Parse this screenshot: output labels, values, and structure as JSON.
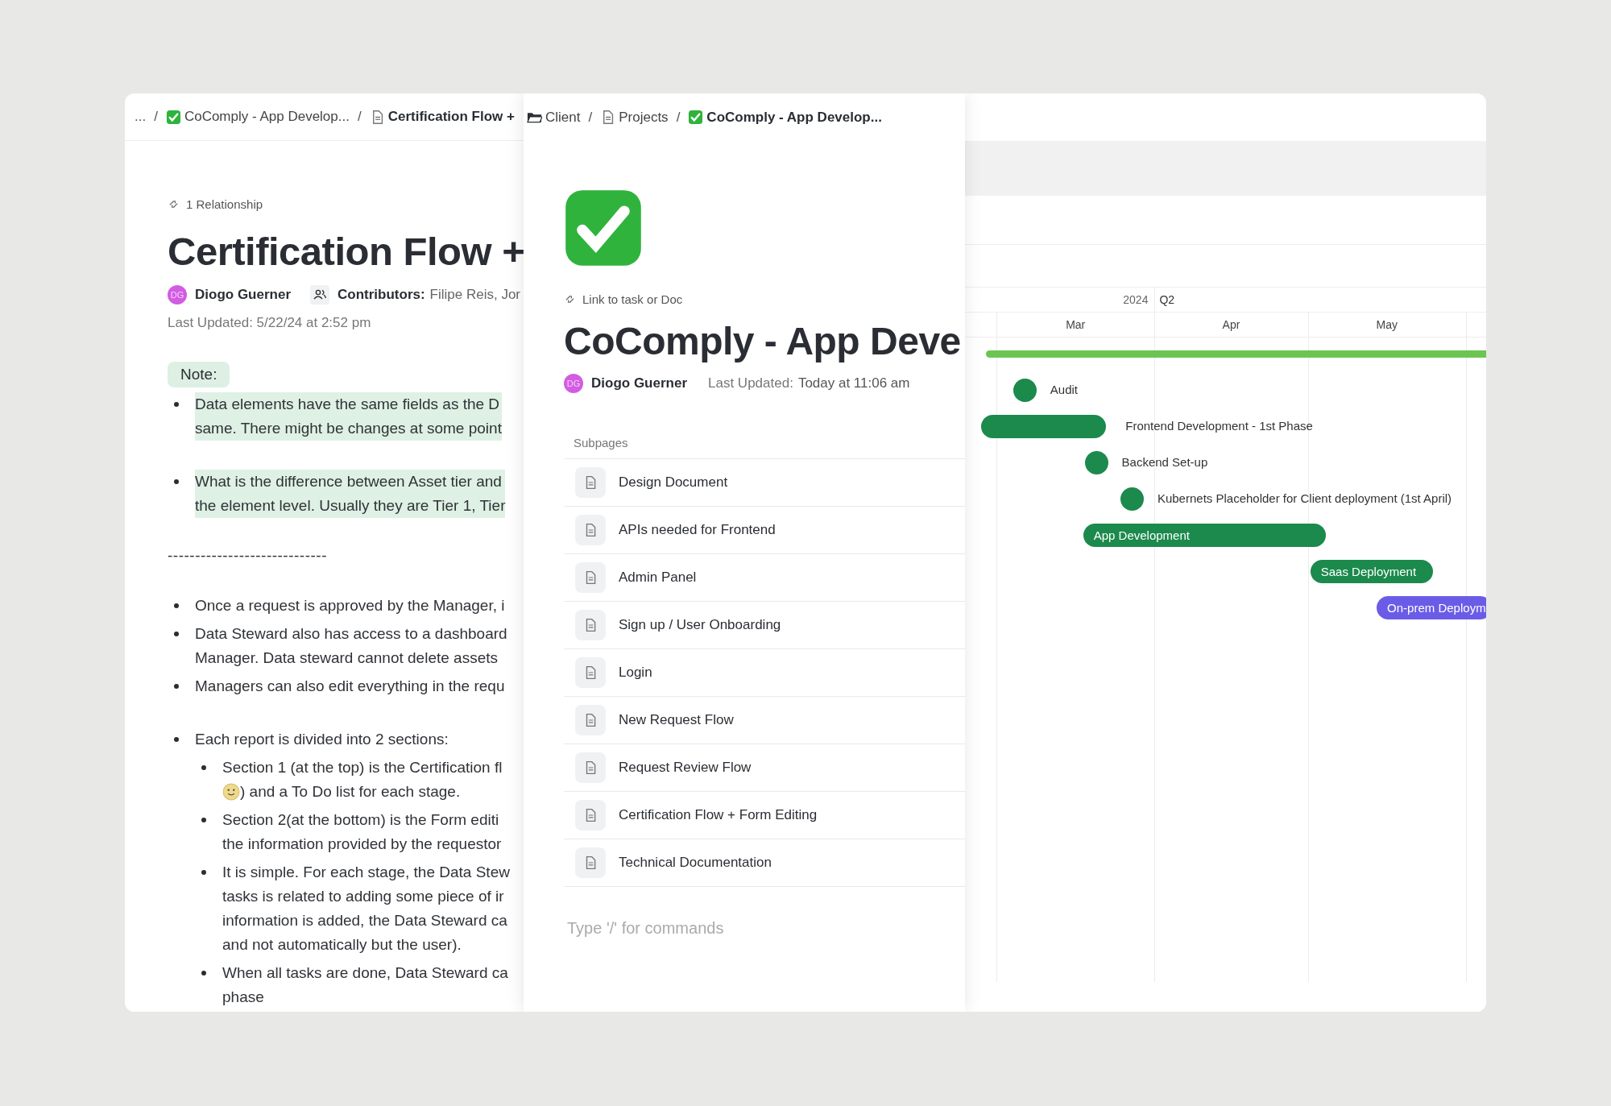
{
  "left_doc": {
    "breadcrumb": [
      {
        "kind": "ellipsis",
        "text": "..."
      },
      {
        "kind": "separator",
        "text": "/"
      },
      {
        "kind": "task_link",
        "text": "CoComply - App Develop...",
        "current": false
      },
      {
        "kind": "separator",
        "text": "/"
      },
      {
        "kind": "doc_link",
        "text": "Certification Flow +",
        "current": true
      }
    ],
    "relationship": "1 Relationship",
    "title": "Certification Flow +",
    "author": {
      "initials": "DG",
      "name": "Diogo Guerner"
    },
    "contributors": {
      "label": "Contributors:",
      "names": "Filipe Reis, Jor"
    },
    "last_updated": "Last Updated: 5/22/24 at 2:52 pm",
    "note_label": "Note:",
    "blocks": [
      {
        "kind": "bullets",
        "items": [
          {
            "highlighted": true,
            "lines": [
              "Data elements have the same fields as the D",
              "same. There might be changes at some point"
            ]
          }
        ]
      },
      {
        "kind": "bullets",
        "items": [
          {
            "highlighted": true,
            "lines": [
              "What is the difference between Asset tier and",
              "the element level. Usually they are Tier 1, Tier"
            ]
          }
        ]
      },
      {
        "kind": "rule_text",
        "text": "-----------------------------"
      },
      {
        "kind": "bullets",
        "items": [
          {
            "highlighted": false,
            "lines": [
              "Once a request is approved by the Manager, i"
            ]
          },
          {
            "highlighted": false,
            "lines": [
              "Data Steward also has access to a dashboard",
              "Manager. Data steward cannot delete assets"
            ]
          },
          {
            "highlighted": false,
            "lines": [
              "Managers can also edit everything in the requ"
            ]
          }
        ]
      },
      {
        "kind": "bullets",
        "items": [
          {
            "highlighted": false,
            "lines": [
              "Each report is divided into 2 sections:"
            ],
            "children": [
              {
                "highlighted": false,
                "lines": [
                  "Section 1 (at the top) is the Certification fl",
                  {
                    "kind": "smiley_line",
                    "text": ") and a To Do list for each stage."
                  }
                ]
              },
              {
                "highlighted": false,
                "lines": [
                  "Section 2(at the bottom) is the Form editi",
                  "the information provided by the requestor"
                ]
              },
              {
                "highlighted": false,
                "lines": [
                  "It is simple. For each stage, the Data Stew",
                  "tasks is related to adding some piece of ir",
                  "information is added, the Data Steward ca",
                  "and not automatically but the user)."
                ]
              },
              {
                "highlighted": false,
                "lines": [
                  "When all tasks are done, Data Steward ca",
                  "phase"
                ]
              }
            ]
          }
        ]
      }
    ]
  },
  "middle_doc": {
    "breadcrumb": [
      {
        "kind": "folder_link",
        "text": "Client",
        "current": false
      },
      {
        "kind": "separator",
        "text": "/"
      },
      {
        "kind": "doc_link",
        "text": "Projects",
        "current": false
      },
      {
        "kind": "separator",
        "text": "/"
      },
      {
        "kind": "task_link",
        "text": "CoComply - App Develop...",
        "current": true
      }
    ],
    "link_label": "Link to task or Doc",
    "title": "CoComply - App Deve",
    "author": {
      "initials": "DG",
      "name": "Diogo Guerner"
    },
    "updated_label": "Last Updated:",
    "updated_value": "Today at 11:06 am",
    "subpages": {
      "heading": "Subpages",
      "items": [
        "Design Document",
        "APIs needed for Frontend",
        "Admin Panel",
        "Sign up / User Onboarding",
        "Login",
        "New Request Flow",
        "Request Review Flow",
        "Certification Flow + Form Editing",
        "Technical Documentation"
      ]
    },
    "editor": {
      "placeholder": "Type '/' for commands"
    }
  },
  "gantt": {
    "year": "2024",
    "quarter": "Q2",
    "months": [
      "Mar",
      "Apr",
      "May"
    ],
    "items": [
      {
        "kind": "summary",
        "color": "#6cc551"
      },
      {
        "kind": "milestone",
        "label": "Audit",
        "color": "#1b8a4c"
      },
      {
        "kind": "bar_outside_label",
        "label": "Frontend Development - 1st Phase",
        "color": "#1b8a4c"
      },
      {
        "kind": "milestone",
        "label": "Backend Set-up",
        "color": "#1b8a4c"
      },
      {
        "kind": "milestone",
        "label": "Kubernets Placeholder for Client deployment (1st April)",
        "color": "#1b8a4c"
      },
      {
        "kind": "bar",
        "label": "App Development",
        "color": "#1b8a4c"
      },
      {
        "kind": "bar",
        "label": "Saas Deployment",
        "color": "#1b8a4c"
      },
      {
        "kind": "bar",
        "label": "On-prem Deploym",
        "color": "#6b5ce7"
      }
    ]
  }
}
